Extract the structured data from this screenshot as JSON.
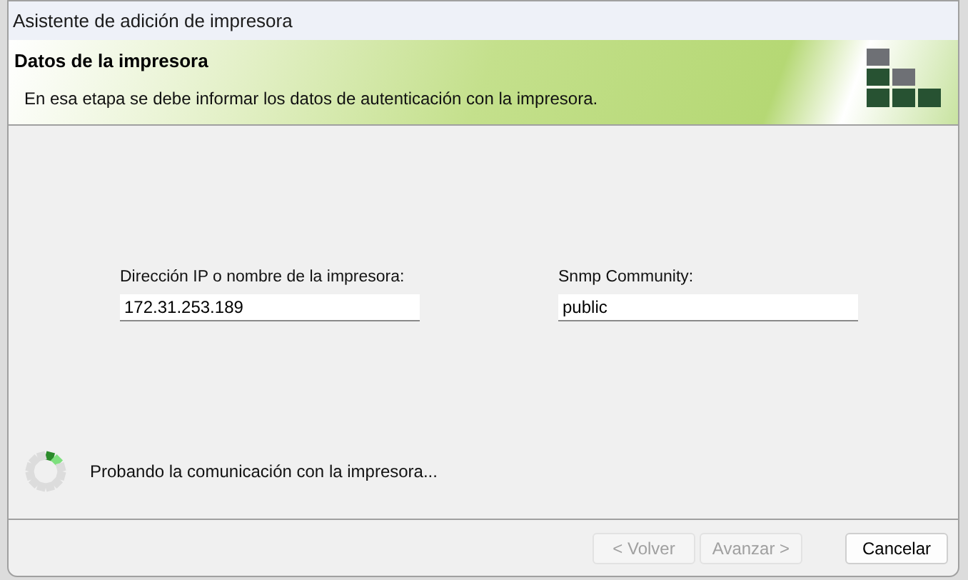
{
  "window": {
    "title": "Asistente de adición de impresora"
  },
  "header": {
    "title": "Datos de la impresora",
    "subtitle": "En esa etapa se debe informar los datos de autenticación con la impresora."
  },
  "fields": [
    {
      "label": "Dirección IP o nombre de la impresora:",
      "value": "172.31.253.189"
    },
    {
      "label": "Snmp Community:",
      "value": "public"
    }
  ],
  "status": {
    "text": "Probando la comunicación con la impresora..."
  },
  "buttons": [
    {
      "label": "< Volver",
      "disabled": true
    },
    {
      "label": "Avanzar >",
      "disabled": true
    },
    {
      "label": "Cancelar",
      "disabled": false
    }
  ]
}
